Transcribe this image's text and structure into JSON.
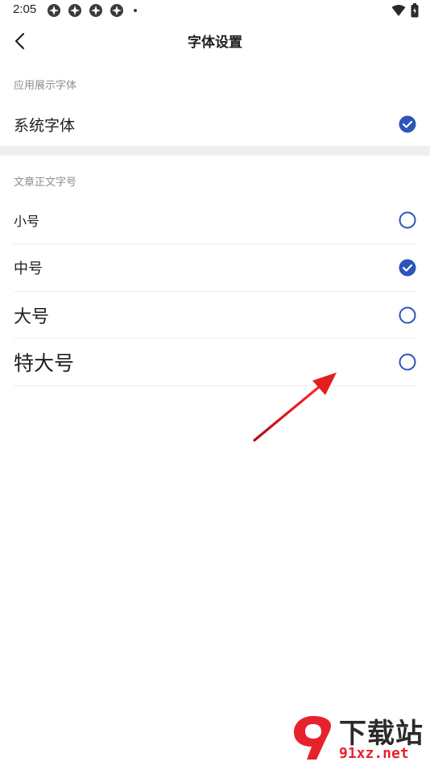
{
  "status_bar": {
    "time": "2:05",
    "notification_icons": [
      "pinwheel-icon",
      "pinwheel-icon",
      "pinwheel-icon",
      "pinwheel-icon"
    ],
    "right_icons": [
      "wifi-icon",
      "battery-icon"
    ]
  },
  "header": {
    "title": "字体设置",
    "back_icon": "chevron-left-icon"
  },
  "app_font_section": {
    "label": "应用展示字体",
    "items": [
      {
        "label": "系统字体",
        "selected": true
      }
    ]
  },
  "article_font_size_section": {
    "label": "文章正文字号",
    "items": [
      {
        "label": "小号",
        "selected": false
      },
      {
        "label": "中号",
        "selected": true
      },
      {
        "label": "大号",
        "selected": false
      },
      {
        "label": "特大号",
        "selected": false
      }
    ]
  },
  "colors": {
    "accent": "#2b56b8",
    "annotation_arrow": "#e31e1e",
    "watermark_red": "#e8222c"
  },
  "watermark": {
    "title": "下载站",
    "url": "91xz.net"
  }
}
